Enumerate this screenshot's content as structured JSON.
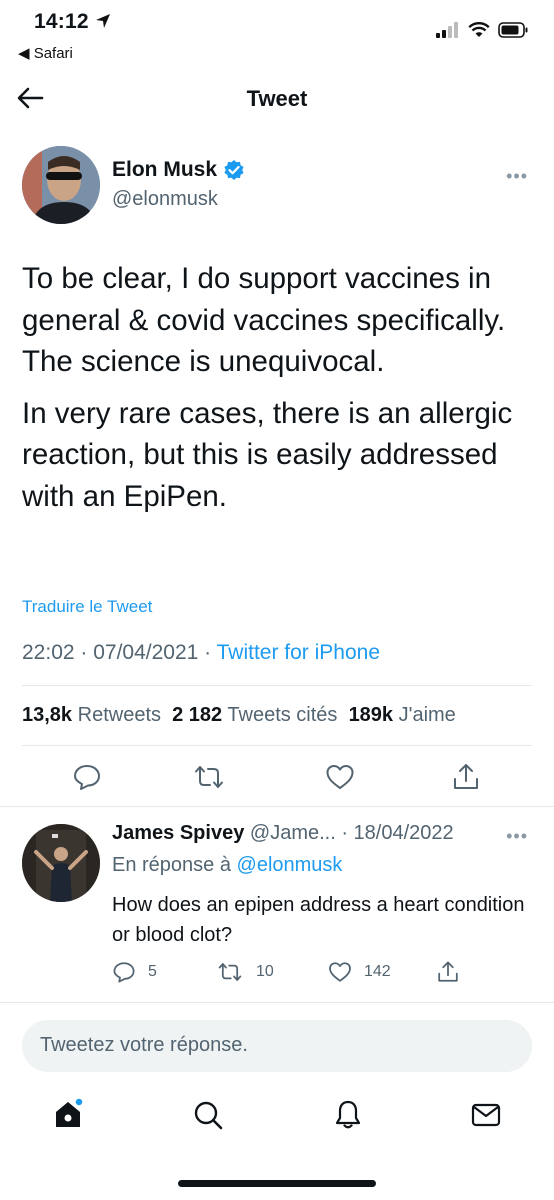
{
  "status_bar": {
    "time": "14:12",
    "back_app": "◀ Safari"
  },
  "header": {
    "title": "Tweet"
  },
  "tweet": {
    "author_name": "Elon Musk",
    "author_handle": "@elonmusk",
    "more_label": "•••",
    "paragraph_1": "To be clear, I do support vaccines in general & covid vaccines specifically. The science is unequivocal.",
    "paragraph_2": "In very rare cases, there is an allergic reaction, but this is easily addressed with an EpiPen.",
    "translate_label": "Traduire le Tweet",
    "datetime": "22:02 · 07/04/2021 · ",
    "source": "Twitter for iPhone",
    "retweets_count": "13,8k",
    "retweets_label": "Retweets",
    "quotes_count": "2 182",
    "quotes_label": "Tweets cités",
    "likes_count": "189k",
    "likes_label": "J'aime"
  },
  "reply": {
    "name": "James Spivey",
    "handle_date": "@Jame... · 18/04/2022",
    "more_label": "•••",
    "reply_to_prefix": "En réponse à ",
    "reply_to_handle": "@elonmusk",
    "text": "How does an epipen address a heart condition or blood clot?",
    "reply_count": "5",
    "retweet_count": "10",
    "like_count": "142"
  },
  "composer": {
    "placeholder": "Tweetez votre réponse."
  },
  "colors": {
    "accent": "#1d9bf0",
    "text": "#0f1419",
    "secondary": "#536471",
    "divider": "#e6e9eb"
  },
  "icons": [
    "back-arrow-icon",
    "verified-badge-icon",
    "reply-icon",
    "retweet-icon",
    "like-icon",
    "share-icon",
    "home-icon",
    "search-icon",
    "notifications-icon",
    "messages-icon"
  ]
}
